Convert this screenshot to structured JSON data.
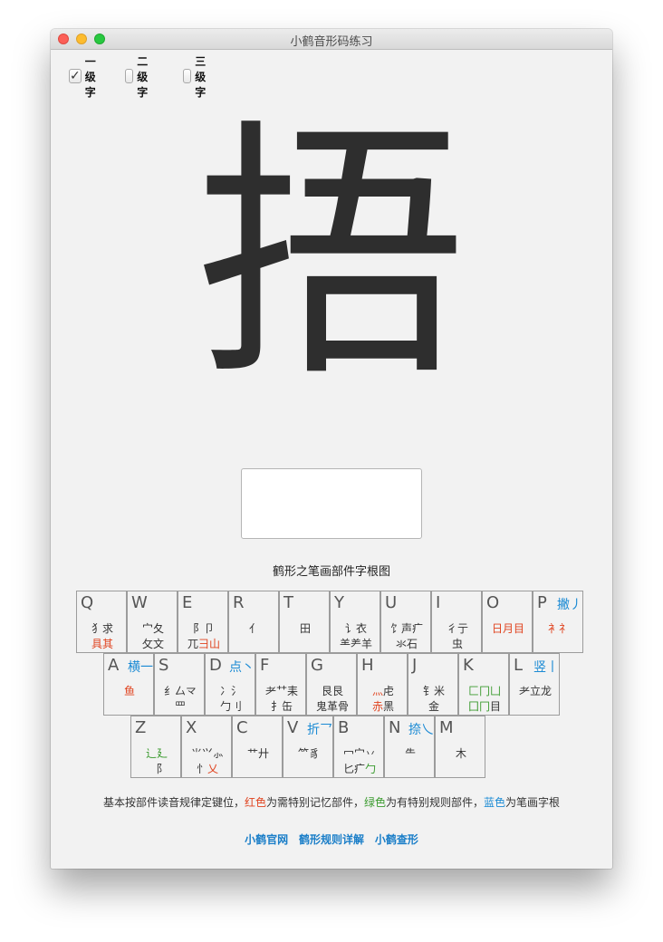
{
  "window": {
    "title": "小鹤音形码练习"
  },
  "levels": [
    {
      "label": "一级字",
      "checked": true
    },
    {
      "label": "二级字",
      "checked": false
    },
    {
      "label": "三级字",
      "checked": false
    }
  ],
  "main": {
    "character": "捂",
    "answer_value": ""
  },
  "chart": {
    "title": "鹤形之笔画部件字根图",
    "rows": [
      [
        {
          "letter": "Q",
          "stroke": "",
          "r1": [
            {
              "t": "犭求",
              "c": "n"
            }
          ],
          "r2": [
            {
              "t": "具",
              "c": "r"
            },
            {
              "t": "其",
              "c": "r"
            }
          ]
        },
        {
          "letter": "W",
          "stroke": "",
          "r1": [
            {
              "t": "宀夂",
              "c": "n"
            }
          ],
          "r2": [
            {
              "t": "攵文",
              "c": "n"
            }
          ]
        },
        {
          "letter": "E",
          "stroke": "",
          "r1": [
            {
              "t": "阝卩",
              "c": "n"
            }
          ],
          "r2": [
            {
              "t": "⺎",
              "c": "n"
            },
            {
              "t": "彐山",
              "c": "r"
            }
          ]
        },
        {
          "letter": "R",
          "stroke": "",
          "r1": [
            {
              "t": "亻",
              "c": "n"
            }
          ],
          "r2": []
        },
        {
          "letter": "T",
          "stroke": "",
          "r1": [
            {
              "t": "田",
              "c": "n"
            }
          ],
          "r2": []
        },
        {
          "letter": "Y",
          "stroke": "",
          "r1": [
            {
              "t": "讠衣",
              "c": "n"
            }
          ],
          "r2": [
            {
              "t": "⺷⺶羊",
              "c": "n"
            }
          ]
        },
        {
          "letter": "U",
          "stroke": "",
          "r1": [
            {
              "t": "饣声疒",
              "c": "n"
            }
          ],
          "r2": [
            {
              "t": "氺石",
              "c": "n"
            }
          ]
        },
        {
          "letter": "I",
          "stroke": "",
          "r1": [
            {
              "t": "彳亍",
              "c": "n"
            }
          ],
          "r2": [
            {
              "t": "虫",
              "c": "n"
            }
          ]
        },
        {
          "letter": "O",
          "stroke": "",
          "r1": [
            {
              "t": "日月目",
              "c": "r"
            }
          ],
          "r2": []
        },
        {
          "letter": "P",
          "stroke": "撇丿",
          "r1": [
            {
              "t": "衤礻",
              "c": "r"
            }
          ],
          "r2": []
        }
      ],
      [
        {
          "letter": "A",
          "stroke": "横一",
          "r1": [
            {
              "t": "鱼",
              "c": "r"
            }
          ],
          "r2": []
        },
        {
          "letter": "S",
          "stroke": "",
          "r1": [
            {
              "t": "纟厶龴",
              "c": "n"
            }
          ],
          "r2": [
            {
              "t": "罒",
              "c": "n"
            }
          ]
        },
        {
          "letter": "D",
          "stroke": "点丶",
          "r1": [
            {
              "t": "冫氵",
              "c": "n"
            }
          ],
          "r2": [
            {
              "t": "勹刂",
              "c": "n"
            }
          ]
        },
        {
          "letter": "F",
          "stroke": "",
          "r1": [
            {
              "t": "⺹⺿耒",
              "c": "n"
            }
          ],
          "r2": [
            {
              "t": "扌缶",
              "c": "n"
            }
          ]
        },
        {
          "letter": "G",
          "stroke": "",
          "r1": [
            {
              "t": "艮艮",
              "c": "n"
            }
          ],
          "r2": [
            {
              "t": "鬼革骨",
              "c": "n"
            }
          ]
        },
        {
          "letter": "H",
          "stroke": "",
          "r1": [
            {
              "t": "灬",
              "c": "r"
            },
            {
              "t": "虍",
              "c": "n"
            }
          ],
          "r2": [
            {
              "t": "赤",
              "c": "r"
            },
            {
              "t": "黑",
              "c": "n"
            }
          ]
        },
        {
          "letter": "J",
          "stroke": "",
          "r1": [
            {
              "t": "钅米",
              "c": "n"
            }
          ],
          "r2": [
            {
              "t": "金",
              "c": "n"
            }
          ]
        },
        {
          "letter": "K",
          "stroke": "",
          "r1": [
            {
              "t": "匚冂凵",
              "c": "g"
            }
          ],
          "r2": [
            {
              "t": "囗冂",
              "c": "g"
            },
            {
              "t": "目",
              "c": "n"
            }
          ]
        },
        {
          "letter": "L",
          "stroke": "竖丨",
          "r1": [
            {
              "t": "耂立龙",
              "c": "n"
            }
          ],
          "r2": []
        }
      ],
      [
        {
          "letter": "Z",
          "stroke": "",
          "r1": [
            {
              "t": "辶廴",
              "c": "g"
            }
          ],
          "r2": [
            {
              "t": "⻏",
              "c": "n"
            }
          ]
        },
        {
          "letter": "X",
          "stroke": "",
          "r1": [
            {
              "t": "⺌⺍⺗",
              "c": "n"
            }
          ],
          "r2": [
            {
              "t": "忄",
              "c": "n"
            },
            {
              "t": "乂",
              "c": "r"
            }
          ]
        },
        {
          "letter": "C",
          "stroke": "",
          "r1": [
            {
              "t": "艹廾",
              "c": "n"
            }
          ],
          "r2": []
        },
        {
          "letter": "V",
          "stroke": "折乛",
          "r1": [
            {
              "t": "⺮豸",
              "c": "n"
            }
          ],
          "r2": []
        },
        {
          "letter": "B",
          "stroke": "",
          "r1": [
            {
              "t": "冖宀丷",
              "c": "n"
            }
          ],
          "r2": [
            {
              "t": "匕疒",
              "c": "n"
            },
            {
              "t": "勹",
              "c": "g"
            }
          ]
        },
        {
          "letter": "N",
          "stroke": "捺乀",
          "r1": [
            {
              "t": "⺧",
              "c": "n"
            }
          ],
          "r2": []
        },
        {
          "letter": "M",
          "stroke": "",
          "r1": [
            {
              "t": "木",
              "c": "n"
            }
          ],
          "r2": []
        }
      ]
    ]
  },
  "legend": {
    "p1": "基本按部件读音规律定键位，",
    "red": "红色",
    "p2": "为需特别记忆部件，",
    "green": "绿色",
    "p3": "为有特别规则部件，",
    "blue": "蓝色",
    "p4": "为笔画字根"
  },
  "links": [
    "小鹤官网",
    "鹤形规则详解",
    "小鹤查形"
  ],
  "colors": {
    "red": "#e0431f",
    "green": "#3a9a2e",
    "blue": "#1a8ad4"
  }
}
